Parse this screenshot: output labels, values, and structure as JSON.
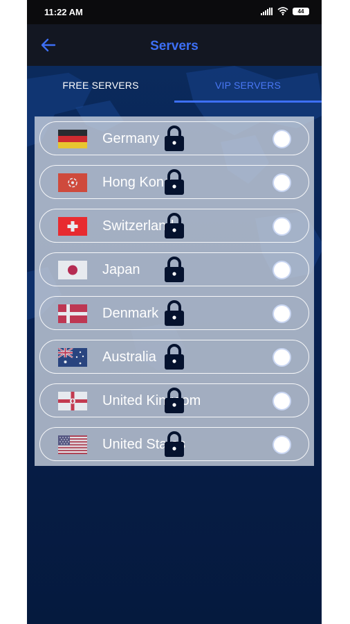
{
  "status_bar": {
    "time": "11:22 AM",
    "battery": "44"
  },
  "app_bar": {
    "title": "Servers",
    "back_icon": "arrow-left-icon"
  },
  "tabs": [
    {
      "label": "FREE SERVERS",
      "selected": false
    },
    {
      "label": "VIP SERVERS",
      "selected": true
    }
  ],
  "servers": [
    {
      "name": "Germany",
      "flag": "germany-flag",
      "locked": true,
      "selected": false
    },
    {
      "name": "Hong Kong",
      "flag": "hong-kong-flag",
      "locked": true,
      "selected": false
    },
    {
      "name": "Switzerland",
      "flag": "switzerland-flag",
      "locked": true,
      "selected": false
    },
    {
      "name": "Japan",
      "flag": "japan-flag",
      "locked": true,
      "selected": false
    },
    {
      "name": "Denmark",
      "flag": "denmark-flag",
      "locked": true,
      "selected": false
    },
    {
      "name": "Australia",
      "flag": "australia-flag",
      "locked": true,
      "selected": false
    },
    {
      "name": "United Kingdom",
      "flag": "northern-ireland-flag",
      "locked": true,
      "selected": false
    },
    {
      "name": "United States",
      "flag": "united-states-flag",
      "locked": true,
      "selected": false
    }
  ],
  "colors": {
    "accent": "#3d6ff5",
    "app_bar": "#131722",
    "background": "#061a3a",
    "panel": "#ced6e2"
  }
}
